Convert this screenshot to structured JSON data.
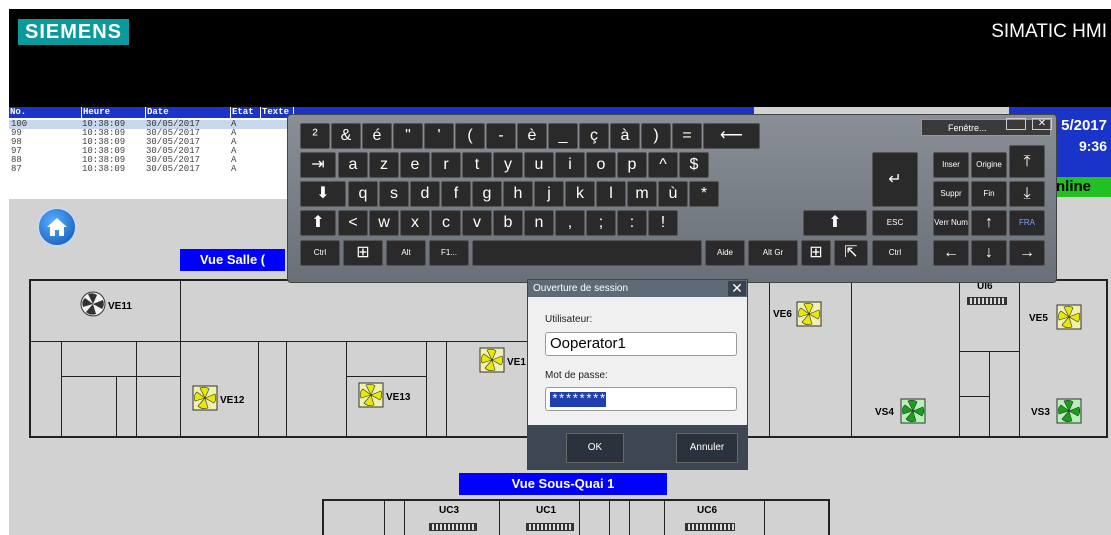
{
  "header": {
    "logo": "SIEMENS",
    "title": "SIMATIC HMI"
  },
  "alarms": {
    "columns": [
      "No.",
      "Heure",
      "Date",
      "Etat",
      "Texte"
    ],
    "rows": [
      [
        "100",
        "10:38:09",
        "30/05/2017",
        "A"
      ],
      [
        "99",
        "10:38:09",
        "30/05/2017",
        "A"
      ],
      [
        "98",
        "10:38:09",
        "30/05/2017",
        "A"
      ],
      [
        "97",
        "10:38:09",
        "30/05/2017",
        "A"
      ],
      [
        "88",
        "10:38:09",
        "30/05/2017",
        "A"
      ],
      [
        "87",
        "10:38:09",
        "30/05/2017",
        "A"
      ]
    ]
  },
  "status": {
    "date": "5/2017",
    "time": "9:36",
    "online": "nline"
  },
  "views": {
    "salle": "Vue Salle (",
    "sous_quai": "Vue Sous-Quai 1"
  },
  "fans": {
    "ve11": "VE11",
    "ve12": "VE12",
    "ve13": "VE13",
    "ve1x": "VE1",
    "ve6": "VE6",
    "ve5": "VE5",
    "vs4": "VS4",
    "vs3": "VS3",
    "ui6": "UI6"
  },
  "units": {
    "uc3": "UC3",
    "uc1": "UC1",
    "uc6": "UC6"
  },
  "keyboard": {
    "window_title": "Fenêtre...",
    "row1": [
      "²",
      "&",
      "é",
      "\"",
      "'",
      "(",
      "-",
      "è",
      "_",
      "ç",
      "à",
      ")",
      "=",
      "⟵"
    ],
    "row2": [
      "⇥",
      "a",
      "z",
      "e",
      "r",
      "t",
      "y",
      "u",
      "i",
      "o",
      "p",
      "^",
      "$"
    ],
    "row3": [
      "⬇",
      "q",
      "s",
      "d",
      "f",
      "g",
      "h",
      "j",
      "k",
      "l",
      "m",
      "ù",
      "*"
    ],
    "row4": [
      "⬆",
      "<",
      "w",
      "x",
      "c",
      "v",
      "b",
      "n",
      ",",
      ";",
      ":",
      "!",
      "⬆"
    ],
    "esc": "ESC",
    "row5": {
      "ctrl_left": "Ctrl",
      "alt": "Alt",
      "f1": "F1...",
      "aide": "Aide",
      "altgr": "Alt Gr",
      "ctrl_right": "Ctrl"
    },
    "nav": {
      "inser": "Inser",
      "origine": "Origine",
      "suppr": "Suppr",
      "fin": "Fin",
      "vernum": "Verr Num",
      "fra": "FRA"
    }
  },
  "login": {
    "title": "Ouverture de session",
    "user_label": "Utilisateur:",
    "user_value": "Ooperator1",
    "pass_label": "Mot de passe:",
    "pass_value": "********",
    "ok": "OK",
    "cancel": "Annuler"
  },
  "colors": {
    "hmi_blue": "#0000ff",
    "alarm_header": "#1a33c8",
    "online": "#22c022",
    "teal_logo": "#0a9a9e"
  }
}
